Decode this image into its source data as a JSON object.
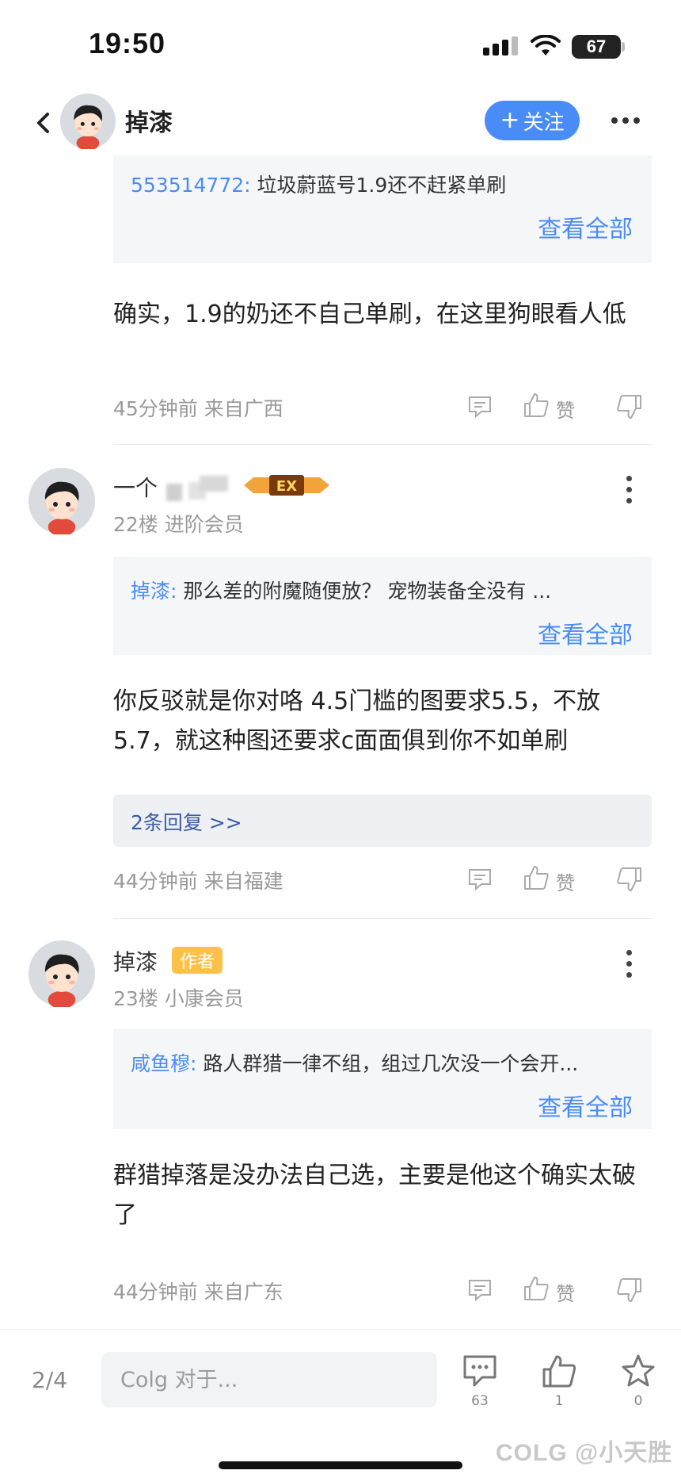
{
  "status": {
    "time": "19:50",
    "battery": "67"
  },
  "header": {
    "name": "掉漆",
    "follow_label": "关注"
  },
  "comments": [
    {
      "quote_author": "553514772:",
      "quote_text": " 垃圾蔚蓝号1.9还不赶紧单刷",
      "view_all": "查看全部",
      "text": "确实，1.9的奶还不自己单刷，在这里狗眼看人低",
      "meta": "45分钟前 来自广西",
      "like_label": "赞"
    },
    {
      "user_name": "一个",
      "floor": "22楼 进阶会员",
      "ex_badge": "EX",
      "quote_author": "掉漆:",
      "quote_text": " 那么差的附魔随便放？ 宠物装备全没有 ...",
      "view_all": "查看全部",
      "text": "你反驳就是你对咯  4.5门槛的图要求5.5，不放5.7，就这种图还要求c面面俱到你不如单刷",
      "replies": "2条回复 >>",
      "meta": "44分钟前 来自福建",
      "like_label": "赞"
    },
    {
      "user_name": "掉漆",
      "author_badge": "作者",
      "floor": "23楼 小康会员",
      "quote_author": "咸鱼穆:",
      "quote_text": " 路人群猎一律不组，组过几次没一个会开...",
      "view_all": "查看全部",
      "text": "群猎掉落是没办法自己选，主要是他这个确实太破了",
      "meta": "44分钟前 来自广东",
      "like_label": "赞"
    }
  ],
  "bottom_bar": {
    "page": "2/4",
    "input_placeholder": "Colg 对于...",
    "comment_count": "63",
    "like_count": "1",
    "star_count": "0",
    "watermark": "COLG @小天胜"
  },
  "colors": {
    "accent": "#4a8cf7",
    "badge": "#ffc04a"
  }
}
